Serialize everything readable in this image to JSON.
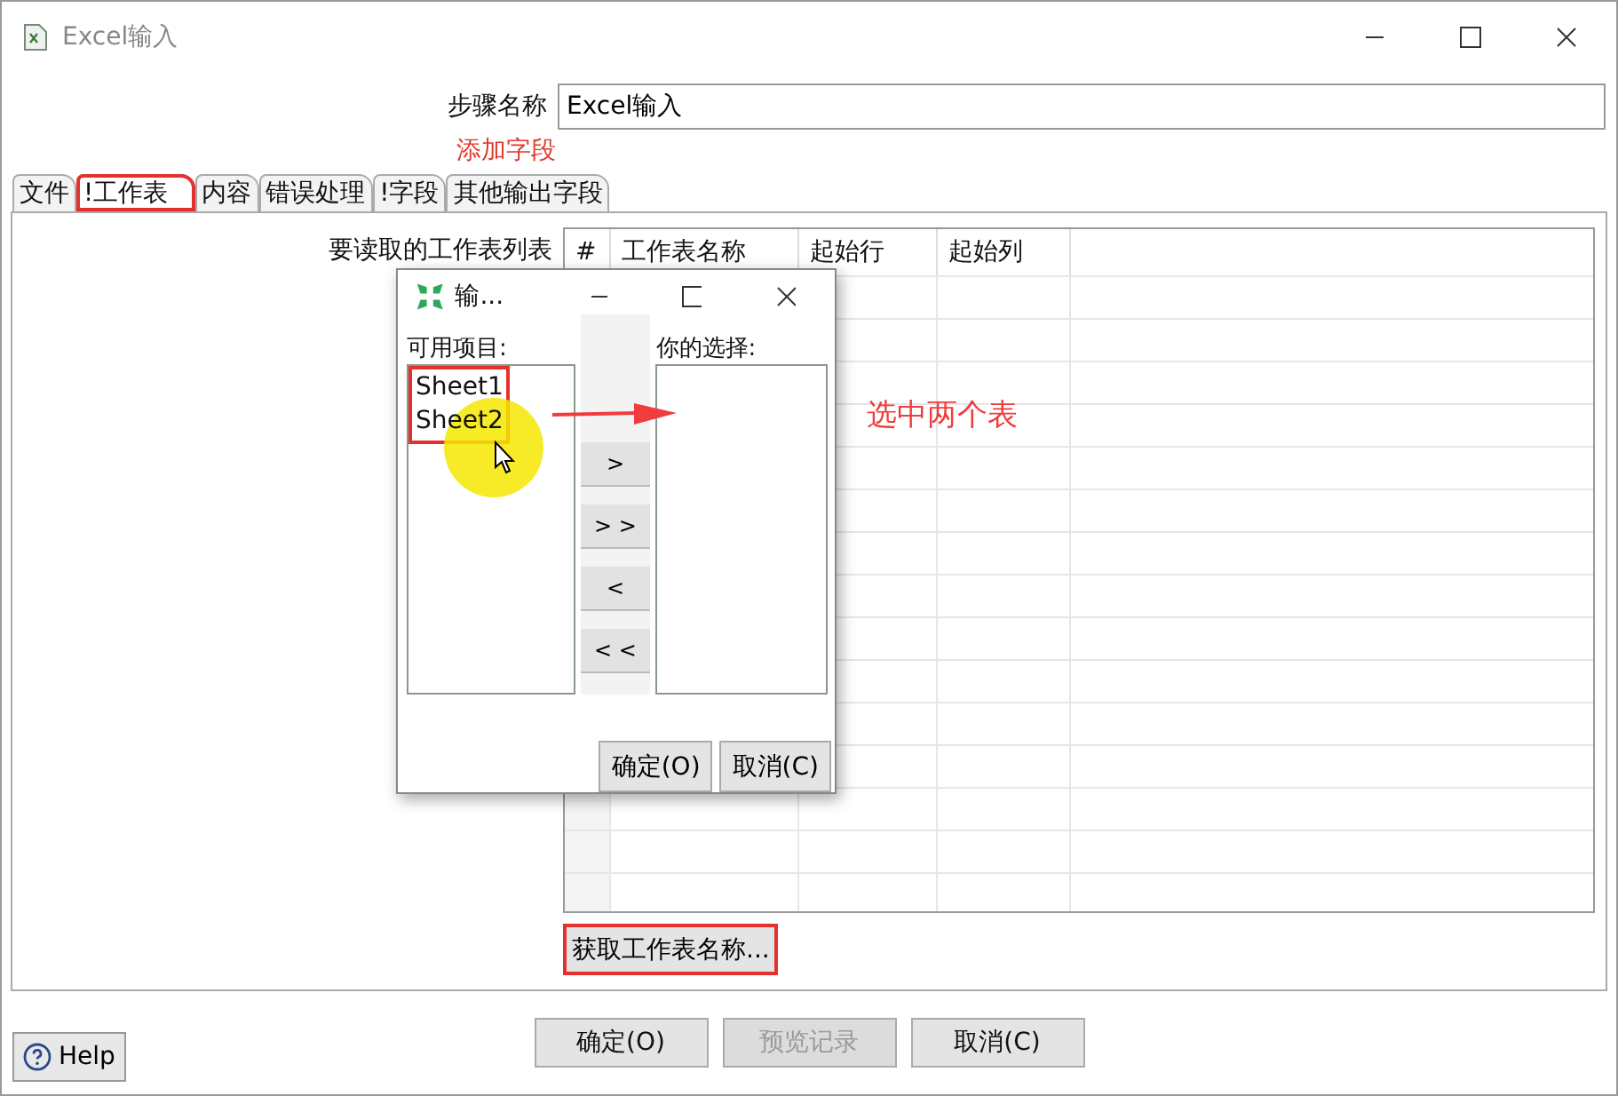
{
  "window": {
    "title": "Excel输入"
  },
  "step_name": {
    "label": "步骤名称",
    "value": "Excel输入"
  },
  "add_field_link": "添加字段",
  "tabs": [
    {
      "label": "文件",
      "selected": false,
      "highlighted": false
    },
    {
      "label": "!工作表",
      "selected": true,
      "highlighted": true
    },
    {
      "label": "内容",
      "selected": false,
      "highlighted": false
    },
    {
      "label": "错误处理",
      "selected": false,
      "highlighted": false
    },
    {
      "label": "!字段",
      "selected": false,
      "highlighted": false
    },
    {
      "label": "其他输出字段",
      "selected": false,
      "highlighted": false
    }
  ],
  "sheets_panel": {
    "label": "要读取的工作表列表",
    "table": {
      "columns": [
        "#",
        "工作表名称",
        "起始行",
        "起始列"
      ]
    },
    "get_names_button": {
      "label": "获取工作表名称...",
      "highlighted": true
    }
  },
  "dialog": {
    "title": "输...",
    "available_label": "可用项目:",
    "available": [
      {
        "label": "Sheet1"
      },
      {
        "label": "Sheet2"
      }
    ],
    "available_highlighted": true,
    "selection_label": "你的选择:",
    "move_buttons": [
      ">",
      "> >",
      "<",
      "< <"
    ],
    "buttons": [
      "确定(O)",
      "取消(C)"
    ]
  },
  "annotation": {
    "text": "选中两个表"
  },
  "help_button": "Help",
  "buttons": [
    {
      "label": "确定(O)",
      "disabled": false
    },
    {
      "label": "预览记录",
      "disabled": true
    },
    {
      "label": "取消(C)",
      "disabled": false
    }
  ]
}
